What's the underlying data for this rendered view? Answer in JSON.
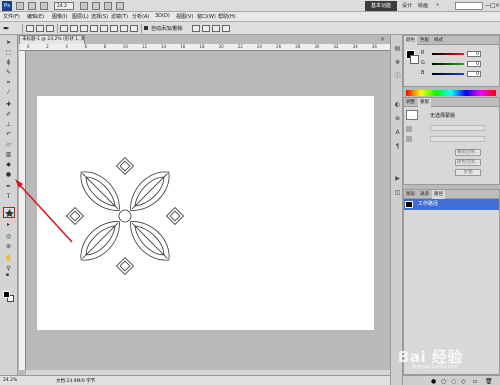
{
  "app": {
    "logo": "Ps",
    "workspace_active": "基本功能",
    "workspace_items": [
      "设计",
      "绘画"
    ],
    "zoom_display": "24.2",
    "window_buttons": [
      "—",
      "□",
      "×"
    ]
  },
  "menu": {
    "items": [
      "文件(F)",
      "编辑(E)",
      "图像(I)",
      "图层(L)",
      "选择(S)",
      "滤镜(T)",
      "分析(A)",
      "3D(D)",
      "视图(V)",
      "窗口(W)",
      "帮助(H)"
    ]
  },
  "options_bar": {
    "auto_add_delete_label": "自动添加/删除"
  },
  "document": {
    "tab_title": "未标题-1 @ 24.2% (形状 1, 路径)",
    "close_glyph": "×",
    "ruler_top_labels": [
      "0",
      "2",
      "4",
      "6",
      "8",
      "10",
      "12",
      "14",
      "16",
      "18",
      "20",
      "22",
      "24",
      "26",
      "28",
      "30",
      "32",
      "34",
      "36"
    ],
    "status_zoom": "24.2%",
    "status_doc": "文档:24.9M/0 字节"
  },
  "panels": {
    "color_tabs": [
      "颜色",
      "色板",
      "样式"
    ],
    "color_channels": [
      {
        "label": "R",
        "value": "0",
        "color": "#e02020"
      },
      {
        "label": "G",
        "value": "0",
        "color": "#20b020"
      },
      {
        "label": "B",
        "value": "0",
        "color": "#2040e0"
      }
    ],
    "adjust_tabs": [
      "调整",
      "蒙版"
    ],
    "mask_label": "无选择蒙版",
    "adjust_buttons": [
      "蒙版边缘...",
      "颜色范围...",
      "反相"
    ],
    "layers_tabs": [
      "图层",
      "通道",
      "路径"
    ],
    "layers": [
      {
        "name": "工作路径",
        "selected": true
      }
    ]
  },
  "watermark": {
    "text": "Bai 经验",
    "url": "jingyan.baidu.com"
  },
  "accents": {
    "annotation_red": "#e01010",
    "selection_blue": "#3f6fd6"
  }
}
